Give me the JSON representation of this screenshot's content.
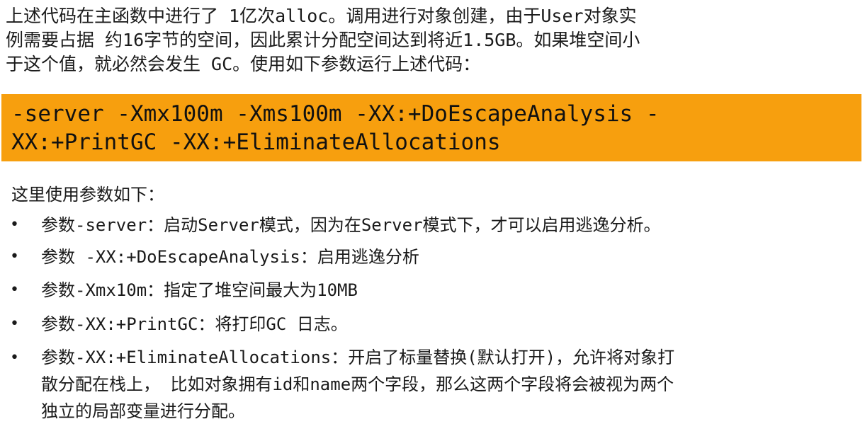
{
  "intro": {
    "lines": [
      "上述代码在主函数中进行了 1亿次alloc。调用进行对象创建，由于User对象实",
      "例需要占据 约16字节的空间，因此累计分配空间达到将近1.5GB。如果堆空间小",
      "于这个值，就必然会发生 GC。使用如下参数运行上述代码："
    ]
  },
  "command": {
    "lines": [
      "-server -Xmx100m -Xms100m -XX:+DoEscapeAnalysis -",
      "XX:+PrintGC -XX:+EliminateAllocations"
    ],
    "background_color": "#f79f0e"
  },
  "params": {
    "heading": "这里使用参数如下：",
    "bullet_symbol": "•",
    "items": [
      {
        "lines": [
          "参数-server：启动Server模式，因为在Server模式下，才可以启用逃逸分析。"
        ]
      },
      {
        "lines": [
          "参数 -XX:+DoEscapeAnalysis：启用逃逸分析"
        ]
      },
      {
        "lines": [
          "参数-Xmx10m：指定了堆空间最大为10MB"
        ]
      },
      {
        "lines": [
          "参数-XX:+PrintGC：将打印GC 日志。"
        ]
      },
      {
        "lines": [
          "参数-XX:+EliminateAllocations：开启了标量替换(默认打开)，允许将对象打",
          "散分配在栈上，  比如对象拥有id和name两个字段，那么这两个字段将会被视为两个",
          "独立的局部变量进行分配。"
        ]
      }
    ]
  }
}
